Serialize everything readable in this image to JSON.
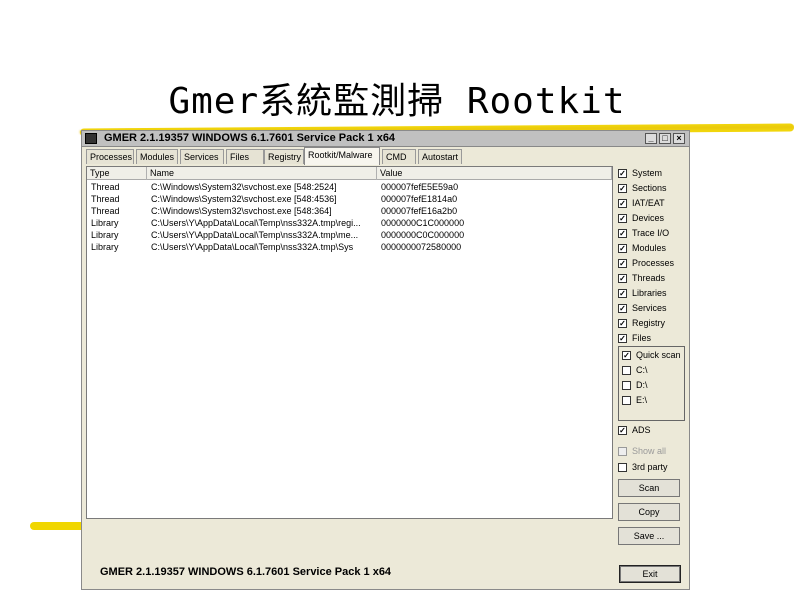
{
  "slide": {
    "title": "Gmer系統監測掃 Rootkit"
  },
  "window": {
    "title": "GMER 2.1.19357    WINDOWS 6.1.7601 Service Pack 1 x64",
    "buttons": {
      "minimize": "_",
      "maximize": "□",
      "close": "×"
    }
  },
  "tabs": [
    {
      "label": "Processes"
    },
    {
      "label": "Modules"
    },
    {
      "label": "Services"
    },
    {
      "label": "Files"
    },
    {
      "label": "Registry"
    },
    {
      "label": "Rootkit/Malware"
    },
    {
      "label": "CMD"
    },
    {
      "label": "Autostart"
    }
  ],
  "active_tab": "Rootkit/Malware",
  "list": {
    "columns": [
      "Type",
      "Name",
      "Value"
    ],
    "rows": [
      {
        "type": "Thread",
        "name": "C:\\Windows\\System32\\svchost.exe [548:2524]",
        "value": "000007fefE5E59a0"
      },
      {
        "type": "Thread",
        "name": "C:\\Windows\\System32\\svchost.exe [548:4536]",
        "value": "000007fefE1814a0"
      },
      {
        "type": "Thread",
        "name": "C:\\Windows\\System32\\svchost.exe [548:364]",
        "value": "000007fefE16a2b0"
      },
      {
        "type": "Library",
        "name": "C:\\Users\\Y\\AppData\\Local\\Temp\\nss332A.tmp\\regi...",
        "value": "0000000C1C000000"
      },
      {
        "type": "Library",
        "name": "C:\\Users\\Y\\AppData\\Local\\Temp\\nss332A.tmp\\me...",
        "value": "0000000C0C000000"
      },
      {
        "type": "Library",
        "name": "C:\\Users\\Y\\AppData\\Local\\Temp\\nss332A.tmp\\Sys",
        "value": "0000000072580000"
      }
    ]
  },
  "options": [
    {
      "label": "System",
      "checked": true
    },
    {
      "label": "Sections",
      "checked": true
    },
    {
      "label": "IAT/EAT",
      "checked": true
    },
    {
      "label": "Devices",
      "checked": true
    },
    {
      "label": "Trace I/O",
      "checked": true
    },
    {
      "label": "Modules",
      "checked": true
    },
    {
      "label": "Processes",
      "checked": true
    },
    {
      "label": "Threads",
      "checked": true
    },
    {
      "label": "Libraries",
      "checked": true
    },
    {
      "label": "Services",
      "checked": true
    },
    {
      "label": "Registry",
      "checked": true
    },
    {
      "label": "Files",
      "checked": true
    }
  ],
  "drives": [
    {
      "label": "Quick scan",
      "checked": true
    },
    {
      "label": "C:\\",
      "checked": false
    },
    {
      "label": "D:\\",
      "checked": false
    },
    {
      "label": "E:\\",
      "checked": false
    }
  ],
  "extra_options": [
    {
      "label": "ADS",
      "checked": true,
      "enabled": true
    },
    {
      "label": "Show all",
      "checked": false,
      "enabled": false
    },
    {
      "label": "3rd party",
      "checked": false,
      "enabled": true
    }
  ],
  "buttons": {
    "scan": "Scan",
    "copy": "Copy",
    "save": "Save ...",
    "exit": "Exit"
  },
  "status": {
    "text": "GMER 2.1.19357    WINDOWS 6.1.7601 Service Pack 1 x64"
  },
  "colors": {
    "accent_yellow": "#f1d400",
    "window_bg": "#ece9d8"
  }
}
